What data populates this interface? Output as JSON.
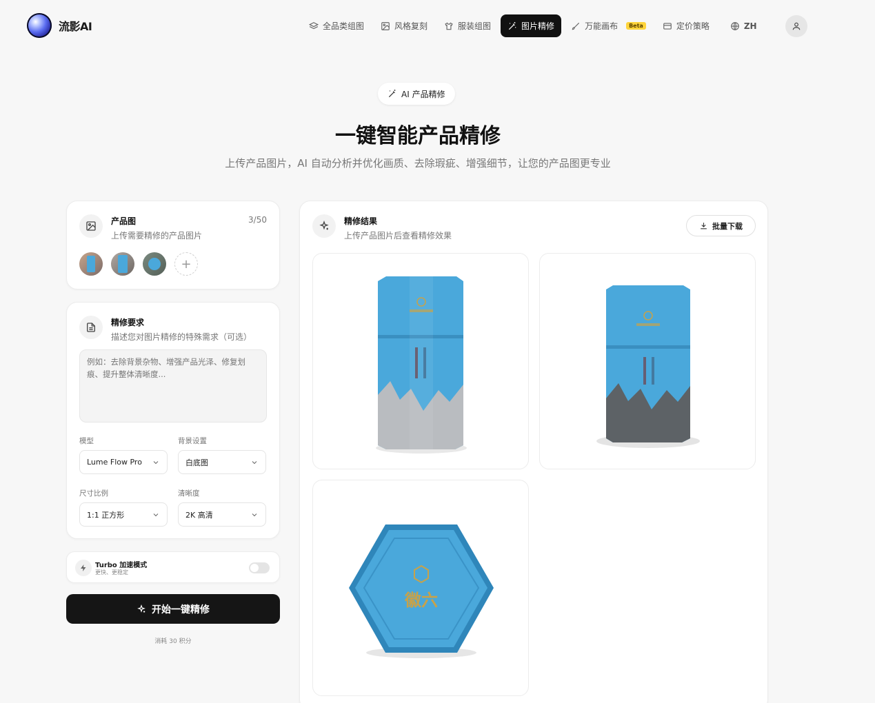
{
  "brand": {
    "name": "流影AI"
  },
  "nav": {
    "items": [
      {
        "label": "全品类组图",
        "icon": "layers-icon"
      },
      {
        "label": "风格复刻",
        "icon": "image-icon"
      },
      {
        "label": "服装组图",
        "icon": "shirt-icon"
      },
      {
        "label": "图片精修",
        "icon": "magic-wand-icon",
        "active": true
      },
      {
        "label": "万能画布",
        "icon": "brush-icon",
        "badge": "Beta"
      },
      {
        "label": "定价策略",
        "icon": "card-icon"
      },
      {
        "label": "ZH",
        "icon": "globe-icon"
      }
    ]
  },
  "hero": {
    "badge": "AI 产品精修",
    "title": "一键智能产品精修",
    "subtitle": "上传产品图片，AI 自动分析并优化画质、去除瑕疵、增强细节，让您的产品图更专业"
  },
  "upload": {
    "title": "产品图",
    "desc": "上传需要精修的产品图片",
    "count": "3/50",
    "add_label": "+"
  },
  "requirements": {
    "title": "精修要求",
    "desc": "描述您对图片精修的特殊需求（可选）",
    "placeholder": "例如：去除背景杂物、增强产品光泽、修复划痕、提升整体清晰度...",
    "model_label": "模型",
    "model_value": "Lume Flow Pro",
    "bg_label": "背景设置",
    "bg_value": "白底图",
    "ratio_label": "尺寸比例",
    "ratio_value": "1:1 正方形",
    "clarity_label": "清晰度",
    "clarity_value": "2K 高清"
  },
  "turbo": {
    "title": "Turbo 加速模式",
    "desc": "更快、更稳定",
    "enabled": false
  },
  "action": {
    "start_label": "开始一键精修",
    "cost": "消耗 30 积分"
  },
  "results": {
    "title": "精修结果",
    "desc": "上传产品图片后查看精修效果",
    "download_label": "批量下载",
    "can_brand_text": "徽六"
  },
  "colors": {
    "accent": "#111111",
    "beta": "#ffd43b",
    "product_blue": "#4aa8db"
  }
}
